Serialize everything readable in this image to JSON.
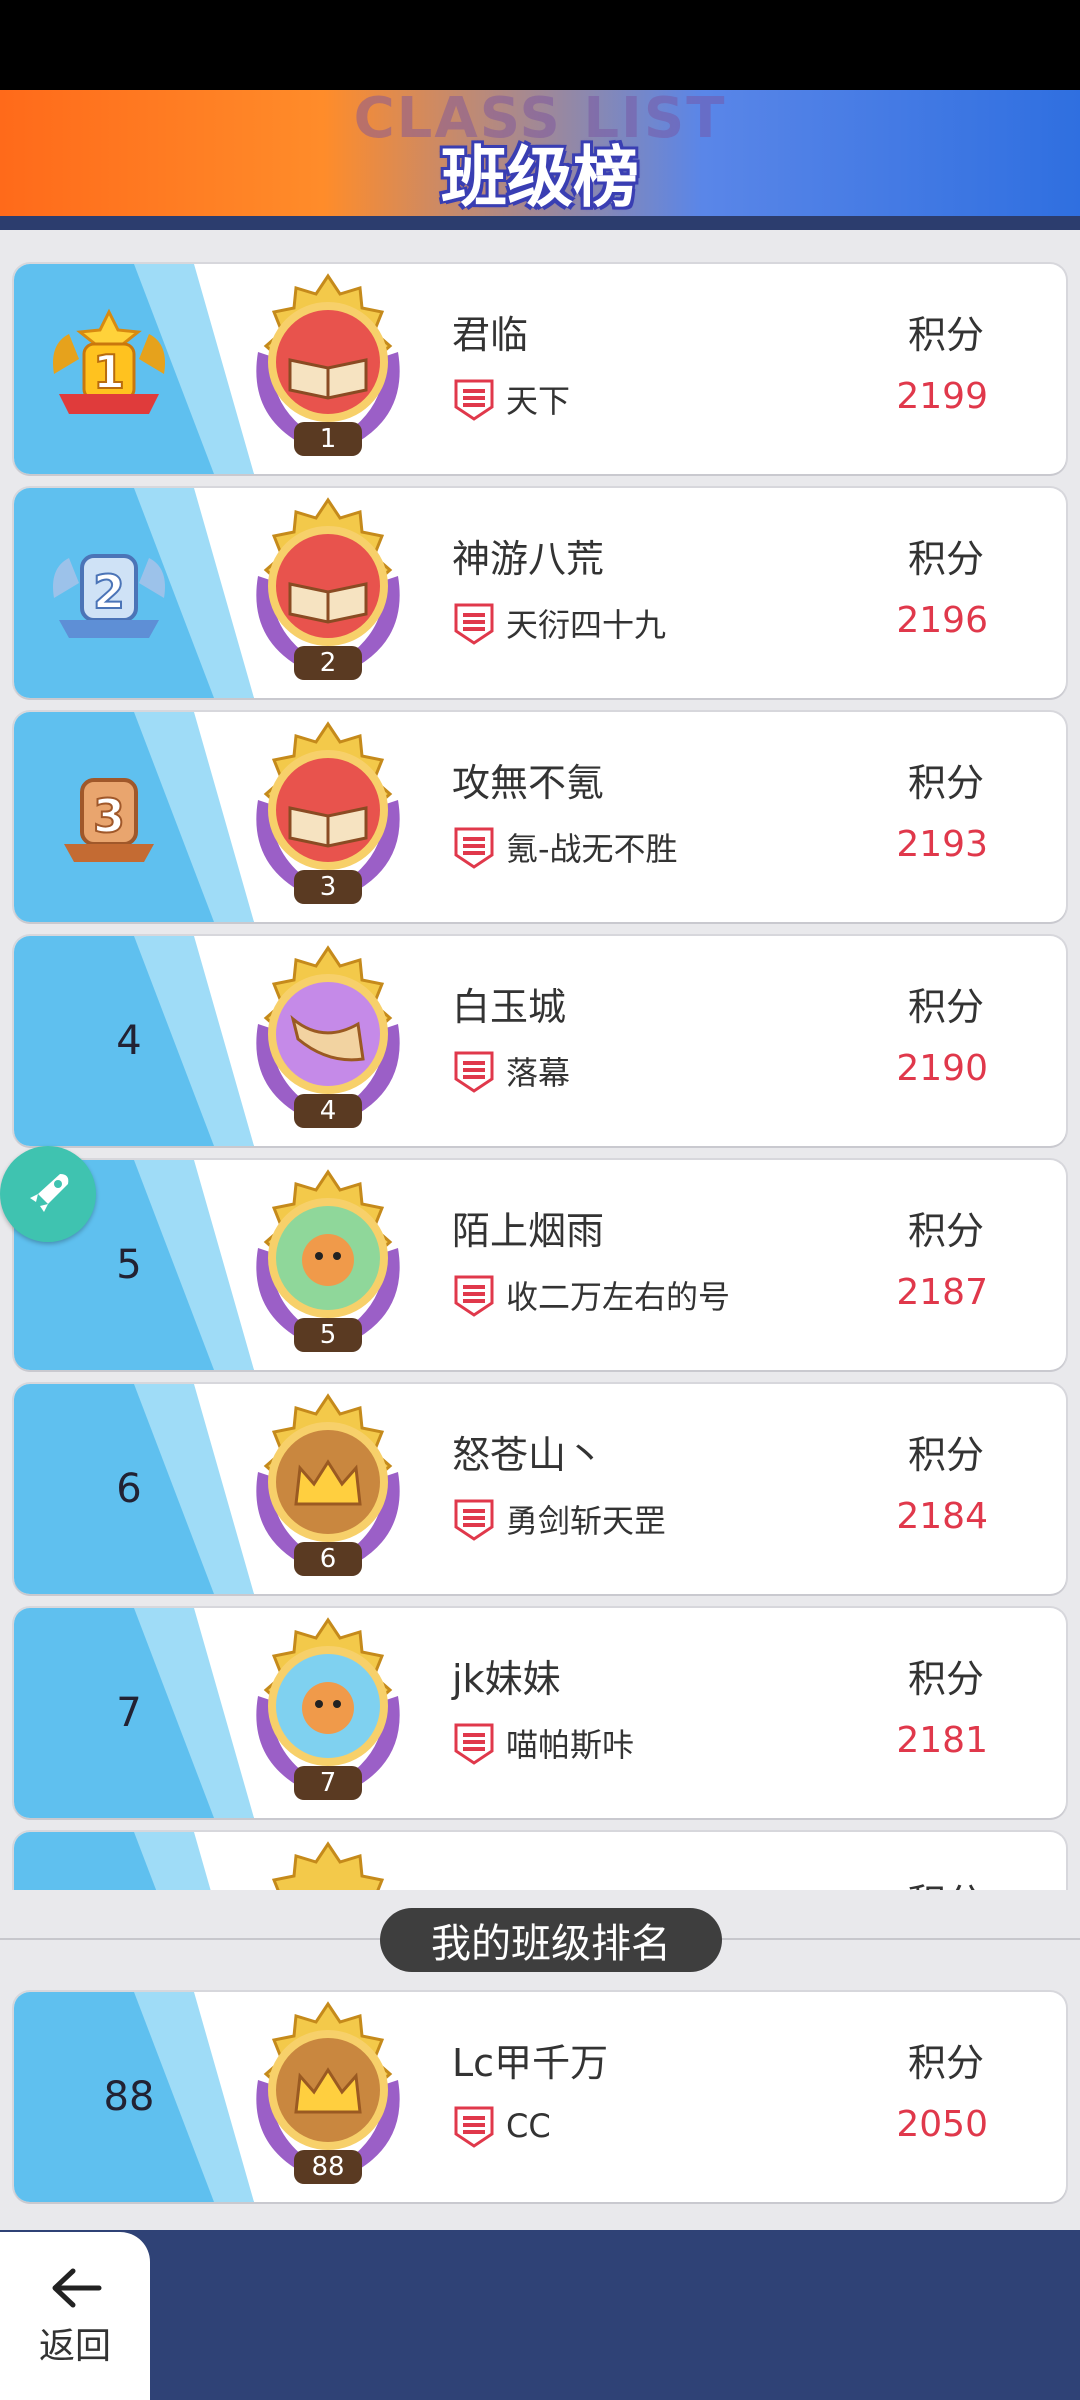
{
  "header": {
    "watermark": "CLASS LIST",
    "title": "班级榜"
  },
  "rows": [
    {
      "rank": "1",
      "name": "君临",
      "guild": "天下",
      "score_label": "积分",
      "score": "2199",
      "badge_num": "1",
      "badge_icon": "book-icon"
    },
    {
      "rank": "2",
      "name": "神游八荒",
      "guild": "天衍四十九",
      "score_label": "积分",
      "score": "2196",
      "badge_num": "2",
      "badge_icon": "book-icon"
    },
    {
      "rank": "3",
      "name": "攻無不氪",
      "guild": "氪-战无不胜",
      "score_label": "积分",
      "score": "2193",
      "badge_num": "3",
      "badge_icon": "book-icon"
    },
    {
      "rank": "4",
      "name": "白玉城",
      "guild": "落幕",
      "score_label": "积分",
      "score": "2190",
      "badge_num": "4",
      "badge_icon": "horn-icon"
    },
    {
      "rank": "5",
      "name": "陌上烟雨",
      "guild": "收二万左右的号",
      "score_label": "积分",
      "score": "2187",
      "badge_num": "5",
      "badge_icon": "cat-icon"
    },
    {
      "rank": "6",
      "name": "怒苍山丶",
      "guild": "勇剑斩天罡",
      "score_label": "积分",
      "score": "2184",
      "badge_num": "6",
      "badge_icon": "crown-icon"
    },
    {
      "rank": "7",
      "name": "jk妹妹",
      "guild": "喵帕斯咔",
      "score_label": "积分",
      "score": "2181",
      "badge_num": "7",
      "badge_icon": "cat-icon"
    }
  ],
  "partial_row": {
    "score_label": "积分"
  },
  "my_section": {
    "title": "我的班级排名",
    "row": {
      "rank": "88",
      "name": "Lc甲千万",
      "guild": "CC",
      "score_label": "积分",
      "score": "2050",
      "badge_num": "88",
      "badge_icon": "crown-icon"
    }
  },
  "footer": {
    "back_label": "返回"
  },
  "colors": {
    "score": "#e0384b",
    "rank_bg": "#5fc0ef",
    "footer": "#2f4276"
  }
}
